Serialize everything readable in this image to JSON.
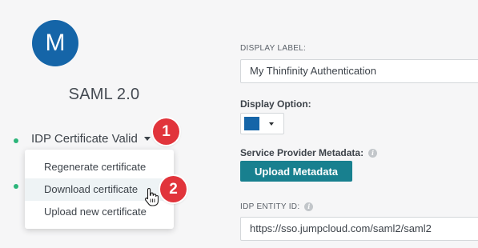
{
  "avatar": {
    "letter": "M",
    "color": "#1565a8"
  },
  "app": {
    "title": "SAML 2.0"
  },
  "certificate": {
    "status_label": "IDP Certificate Valid",
    "menu": [
      {
        "label": "Regenerate certificate"
      },
      {
        "label": "Download certificate"
      },
      {
        "label": "Upload new certificate"
      }
    ]
  },
  "steps": {
    "one": "1",
    "two": "2"
  },
  "form": {
    "display_label": {
      "label": "DISPLAY LABEL:",
      "value": "My Thinfinity Authentication"
    },
    "display_option": {
      "label": "Display Option:",
      "color": "#1565a8"
    },
    "sp_metadata": {
      "label": "Service Provider Metadata:",
      "button": "Upload Metadata"
    },
    "idp_entity_id": {
      "label": "IDP ENTITY ID:",
      "value": "https://sso.jumpcloud.com/saml2/saml2"
    }
  },
  "colors": {
    "status_ok": "#2cb57a",
    "badge": "#e1343b",
    "primary_button": "#18808f"
  }
}
